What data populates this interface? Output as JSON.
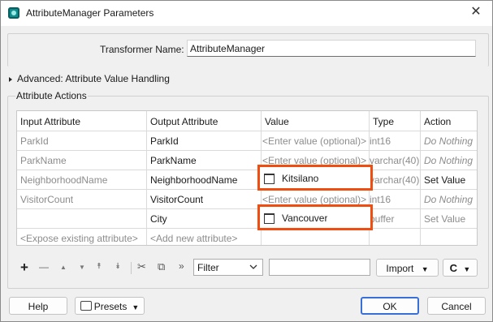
{
  "window": {
    "title": "AttributeManager Parameters",
    "close_glyph": "✕"
  },
  "transformer": {
    "label": "Transformer Name:",
    "value": "AttributeManager"
  },
  "advanced": {
    "label": "Advanced: Attribute Value Handling"
  },
  "actions": {
    "label": "Attribute Actions",
    "headers": [
      "Input Attribute",
      "Output Attribute",
      "Value",
      "Type",
      "Action"
    ],
    "rows": [
      {
        "input": "ParkId",
        "output": "ParkId",
        "value": "<Enter value (optional)>",
        "type": "int16",
        "action": "Do Nothing"
      },
      {
        "input": "ParkName",
        "output": "ParkName",
        "value": "<Enter value (optional)>",
        "type": "varchar(40)",
        "action": "Do Nothing"
      },
      {
        "input": "NeighborhoodName",
        "output": "NeighborhoodName",
        "value": "Kitsilano",
        "type": "varchar(40)",
        "action": "Set Value"
      },
      {
        "input": "VisitorCount",
        "output": "VisitorCount",
        "value": "<Enter value (optional)>",
        "type": "int16",
        "action": "Do Nothing"
      },
      {
        "input": "",
        "output": "City",
        "value": "Vancouver",
        "type": "buffer",
        "action": "Set Value"
      },
      {
        "input": "<Expose existing attribute>",
        "output": "<Add new attribute>",
        "value": "",
        "type": "",
        "action": ""
      }
    ]
  },
  "toolbar": {
    "add": "+",
    "remove": "—",
    "up": "▲",
    "down": "▼",
    "top": "⯭",
    "bottom": "⯯",
    "cut": "✂",
    "copy": "⧉",
    "more": "»",
    "filter_label": "Filter",
    "import_label": "Import",
    "refresh_glyph": "C"
  },
  "footer": {
    "help": "Help",
    "presets": "Presets",
    "ok": "OK",
    "cancel": "Cancel"
  },
  "colors": {
    "highlight": "#f04e11",
    "app_icon": "#0f8c8c",
    "ok_border": "#3a6fd8"
  }
}
